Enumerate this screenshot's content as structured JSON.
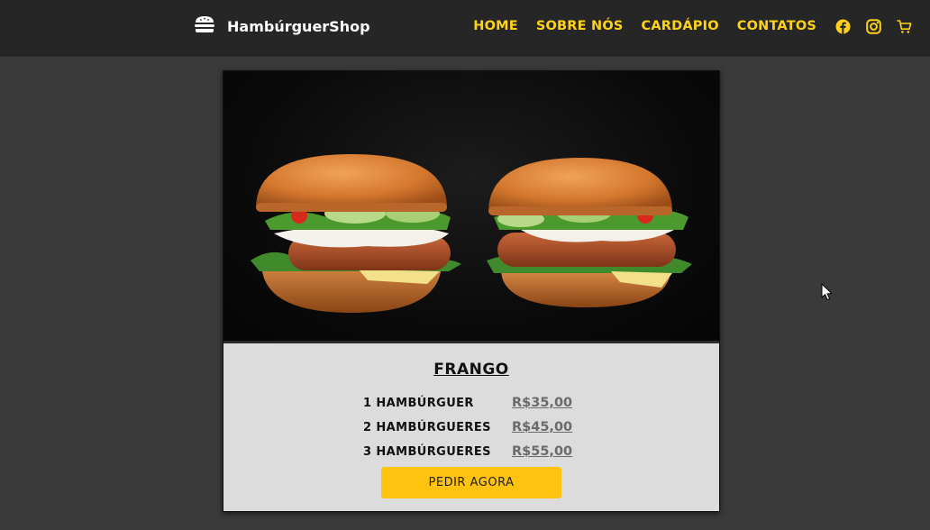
{
  "header": {
    "brand_name": "HambúrguerShop",
    "brand_icon": "burger-icon",
    "nav": [
      {
        "label": "HOME"
      },
      {
        "label": "SOBRE NÓS"
      },
      {
        "label": "CARDÁPIO"
      },
      {
        "label": "CONTATOS"
      }
    ],
    "social_icons": [
      "facebook-icon",
      "instagram-icon",
      "cart-icon"
    ],
    "accent_color": "#ffd21a"
  },
  "product": {
    "title": "FRANGO",
    "prices": [
      {
        "label": "1 HAMBÚRGUER",
        "value": "R$35,00"
      },
      {
        "label": "2 HAMBÚRGUERES",
        "value": "R$45,00"
      },
      {
        "label": "3 HAMBÚRGUERES",
        "value": "R$55,00"
      }
    ],
    "order_button": "PEDIR AGORA",
    "button_color": "#ffc20e"
  }
}
